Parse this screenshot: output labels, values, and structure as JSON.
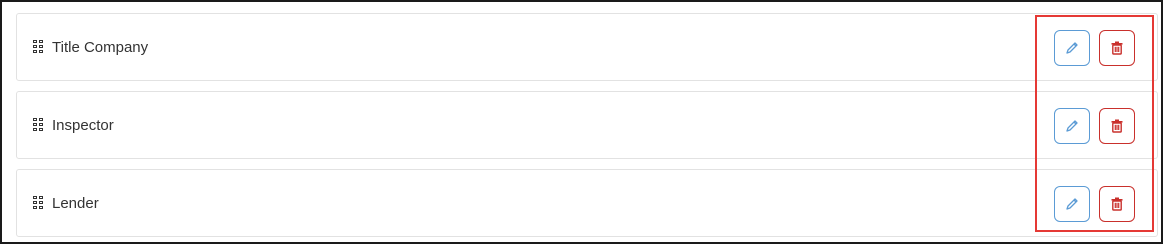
{
  "rows": [
    {
      "label": "Title Company"
    },
    {
      "label": "Inspector"
    },
    {
      "label": "Lender"
    }
  ],
  "colors": {
    "edit_accent": "#5b9bd5",
    "delete_accent": "#c9302c",
    "highlight": "#e53935"
  },
  "icons": {
    "drag": "drag-handle-icon",
    "edit": "pencil-icon",
    "delete": "trash-icon"
  }
}
